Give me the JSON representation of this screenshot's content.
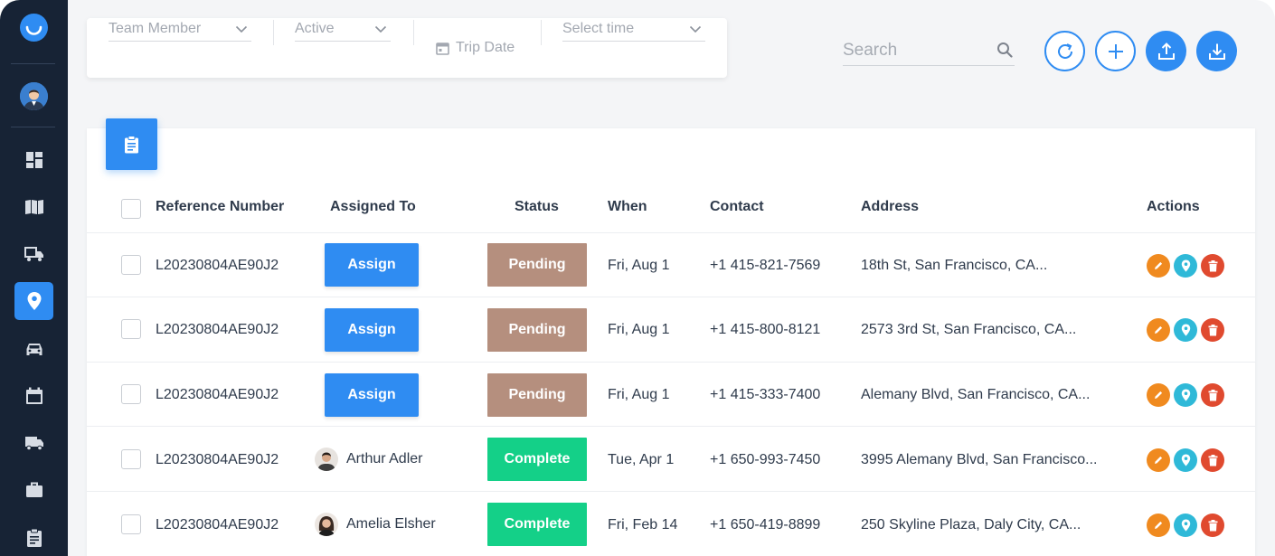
{
  "sidebar": {
    "items": [
      {
        "icon": "dashboard-icon"
      },
      {
        "icon": "map-icon"
      },
      {
        "icon": "dispatch-truck-icon"
      },
      {
        "icon": "location-pin-icon",
        "active": true
      },
      {
        "icon": "car-icon"
      },
      {
        "icon": "calendar-icon"
      },
      {
        "icon": "truck-icon"
      },
      {
        "icon": "briefcase-icon"
      },
      {
        "icon": "clipboard-icon"
      }
    ]
  },
  "filters": {
    "team_member": "Team Member",
    "active": "Active",
    "trip_date": "Trip Date",
    "select_time": "Select time"
  },
  "search": {
    "placeholder": "Search"
  },
  "toolbar": {
    "refresh_icon": "refresh-icon",
    "add_icon": "plus-icon",
    "upload_icon": "upload-icon",
    "download_icon": "download-icon"
  },
  "table": {
    "headers": {
      "reference": "Reference Number",
      "assigned": "Assigned To",
      "status": "Status",
      "when": "When",
      "contact": "Contact",
      "address": "Address",
      "actions": "Actions"
    },
    "rows": [
      {
        "reference": "L20230804AE90J2",
        "assign_label": "Assign",
        "status": "Pending",
        "when": "Fri, Aug 1",
        "contact": "+1 415-821-7569",
        "address": "18th St, San Francisco, CA..."
      },
      {
        "reference": "L20230804AE90J2",
        "assign_label": "Assign",
        "status": "Pending",
        "when": "Fri, Aug 1",
        "contact": "+1 415-800-8121",
        "address": "2573 3rd St, San Francisco, CA..."
      },
      {
        "reference": "L20230804AE90J2",
        "assign_label": "Assign",
        "status": "Pending",
        "when": "Fri, Aug 1",
        "contact": "+1 415-333-7400",
        "address": "Alemany Blvd, San Francisco, CA..."
      },
      {
        "reference": "L20230804AE90J2",
        "assignee": "Arthur Adler",
        "status": "Complete",
        "when": "Tue, Apr 1",
        "contact": "+1 650-993-7450",
        "address": "3995 Alemany Blvd, San Francisco..."
      },
      {
        "reference": "L20230804AE90J2",
        "assignee": "Amelia Elsher",
        "status": "Complete",
        "when": "Fri, Feb 14",
        "contact": "+1 650-419-8899",
        "address": "250 Skyline Plaza, Daly City, CA..."
      }
    ]
  },
  "colors": {
    "accent": "#2f8cf2",
    "pending": "#b58f7e",
    "complete": "#14d088",
    "sidebar": "#172335",
    "edit": "#f08a1f",
    "locate": "#2fb9d8",
    "delete": "#e04a2f"
  }
}
